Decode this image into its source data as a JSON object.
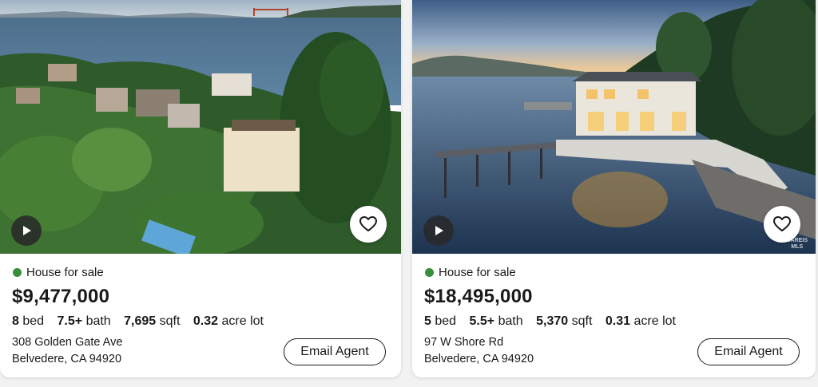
{
  "listings": [
    {
      "status": "House for sale",
      "price": "$9,477,000",
      "beds": "8",
      "beds_unit": "bed",
      "baths": "7.5+",
      "baths_unit": "bath",
      "sqft": "7,695",
      "sqft_unit": "sqft",
      "lot": "0.32",
      "lot_unit": "acre lot",
      "address_line1": "308 Golden Gate Ave",
      "address_line2": "Belvedere, CA 94920",
      "cta": "Email Agent"
    },
    {
      "status": "House for sale",
      "price": "$18,495,000",
      "beds": "5",
      "beds_unit": "bed",
      "baths": "5.5+",
      "baths_unit": "bath",
      "sqft": "5,370",
      "sqft_unit": "sqft",
      "lot": "0.31",
      "lot_unit": "acre lot",
      "address_line1": "97 W Shore Rd",
      "address_line2": "Belvedere, CA 94920",
      "cta": "Email Agent",
      "watermark_line1": "BAREIS",
      "watermark_line2": "MLS"
    }
  ],
  "icons": {
    "play": "play-icon",
    "favorite": "heart-outline-icon",
    "status": "green-dot"
  },
  "colors": {
    "status_dot": "#3a8d3a",
    "text": "#1a1a1a",
    "card_bg": "#ffffff",
    "page_bg": "#f2f2f2"
  }
}
